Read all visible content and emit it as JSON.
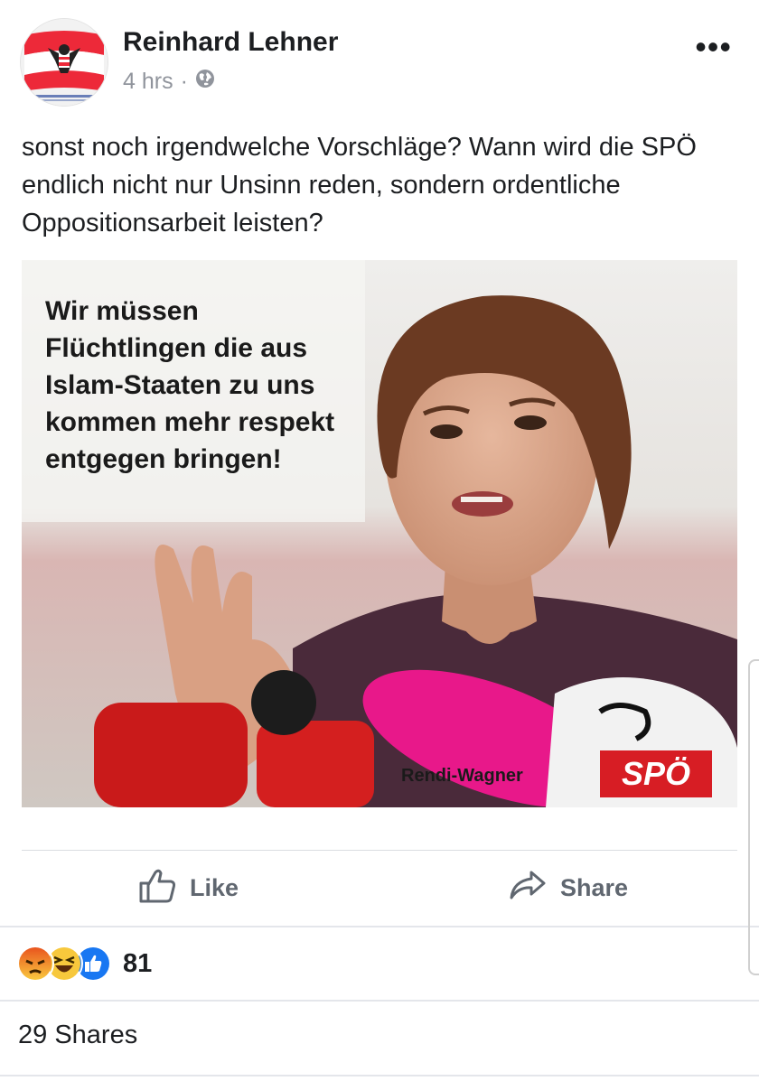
{
  "post": {
    "author": "Reinhard Lehner",
    "time": "4 hrs",
    "separator": "·",
    "privacy_icon": "globe-icon",
    "more_label": "•••",
    "text": "sonst noch irgendwelche Vorschläge? Wann wird die SPÖ endlich nicht nur Unsinn reden, sondern ordentliche Oppositionsarbeit leisten?"
  },
  "image": {
    "quote": "Wir müssen Flüchtlingen die aus Islam-Staaten zu uns kommen mehr respekt entgegen bringen!",
    "name_caption": "Rendi-Wagner",
    "logo_text": "SPÖ"
  },
  "actions": {
    "like_label": "Like",
    "like_icon": "thumbs-up-icon",
    "share_label": "Share",
    "share_icon": "share-arrow-icon"
  },
  "reactions": {
    "icons": [
      "angry-reaction-icon",
      "haha-reaction-icon",
      "like-reaction-icon"
    ],
    "count": "81"
  },
  "shares": {
    "label": "29 Shares"
  },
  "colors": {
    "author_text": "#1c1e21",
    "meta_text": "#90949c",
    "action_text": "#606770",
    "like_blue": "#1877f2",
    "spo_red": "#d71d24"
  }
}
